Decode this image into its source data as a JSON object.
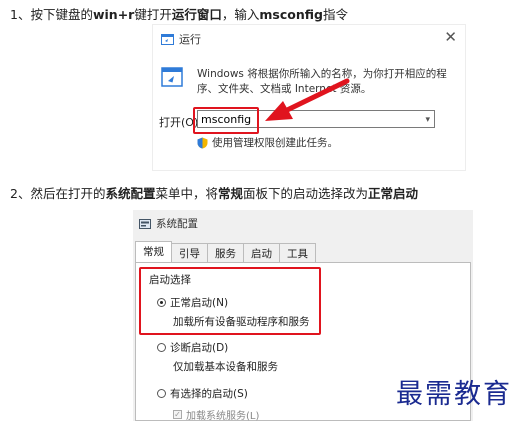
{
  "step1": {
    "prefix": "1、按下键盘的",
    "keys": "win+r",
    "mid": "键打开",
    "target": "运行窗口",
    "mid2": "，输入",
    "cmd": "msconfig",
    "suffix": "指令"
  },
  "run_dialog": {
    "title": "运行",
    "close": "✕",
    "description": "Windows 将根据你所输入的名称，为你打开相应的程序、文件夹、文档或 Internet 资源。",
    "open_label": "打开(O):",
    "input_value": "msconfig",
    "admin_note": "使用管理权限创建此任务。"
  },
  "step2": {
    "prefix": "2、然后在打开的",
    "target": "系统配置",
    "mid": "菜单中，将",
    "tab": "常规",
    "mid2": "面板下的启动选择改为",
    "option": "正常启动"
  },
  "msconfig": {
    "title": "系统配置",
    "tabs": [
      "常规",
      "引导",
      "服务",
      "启动",
      "工具"
    ],
    "group_label": "启动选择",
    "options": [
      {
        "label": "正常启动(N)",
        "desc": "加载所有设备驱动程序和服务",
        "selected": true
      },
      {
        "label": "诊断启动(D)",
        "desc": "仅加载基本设备和服务",
        "selected": false
      },
      {
        "label": "有选择的启动(S)",
        "desc": "",
        "selected": false
      }
    ],
    "checkbox_label": "加载系统服务(L)"
  },
  "watermark": "最需教育",
  "colors": {
    "highlight": "#e0141e",
    "watermark": "#1a2a90"
  }
}
